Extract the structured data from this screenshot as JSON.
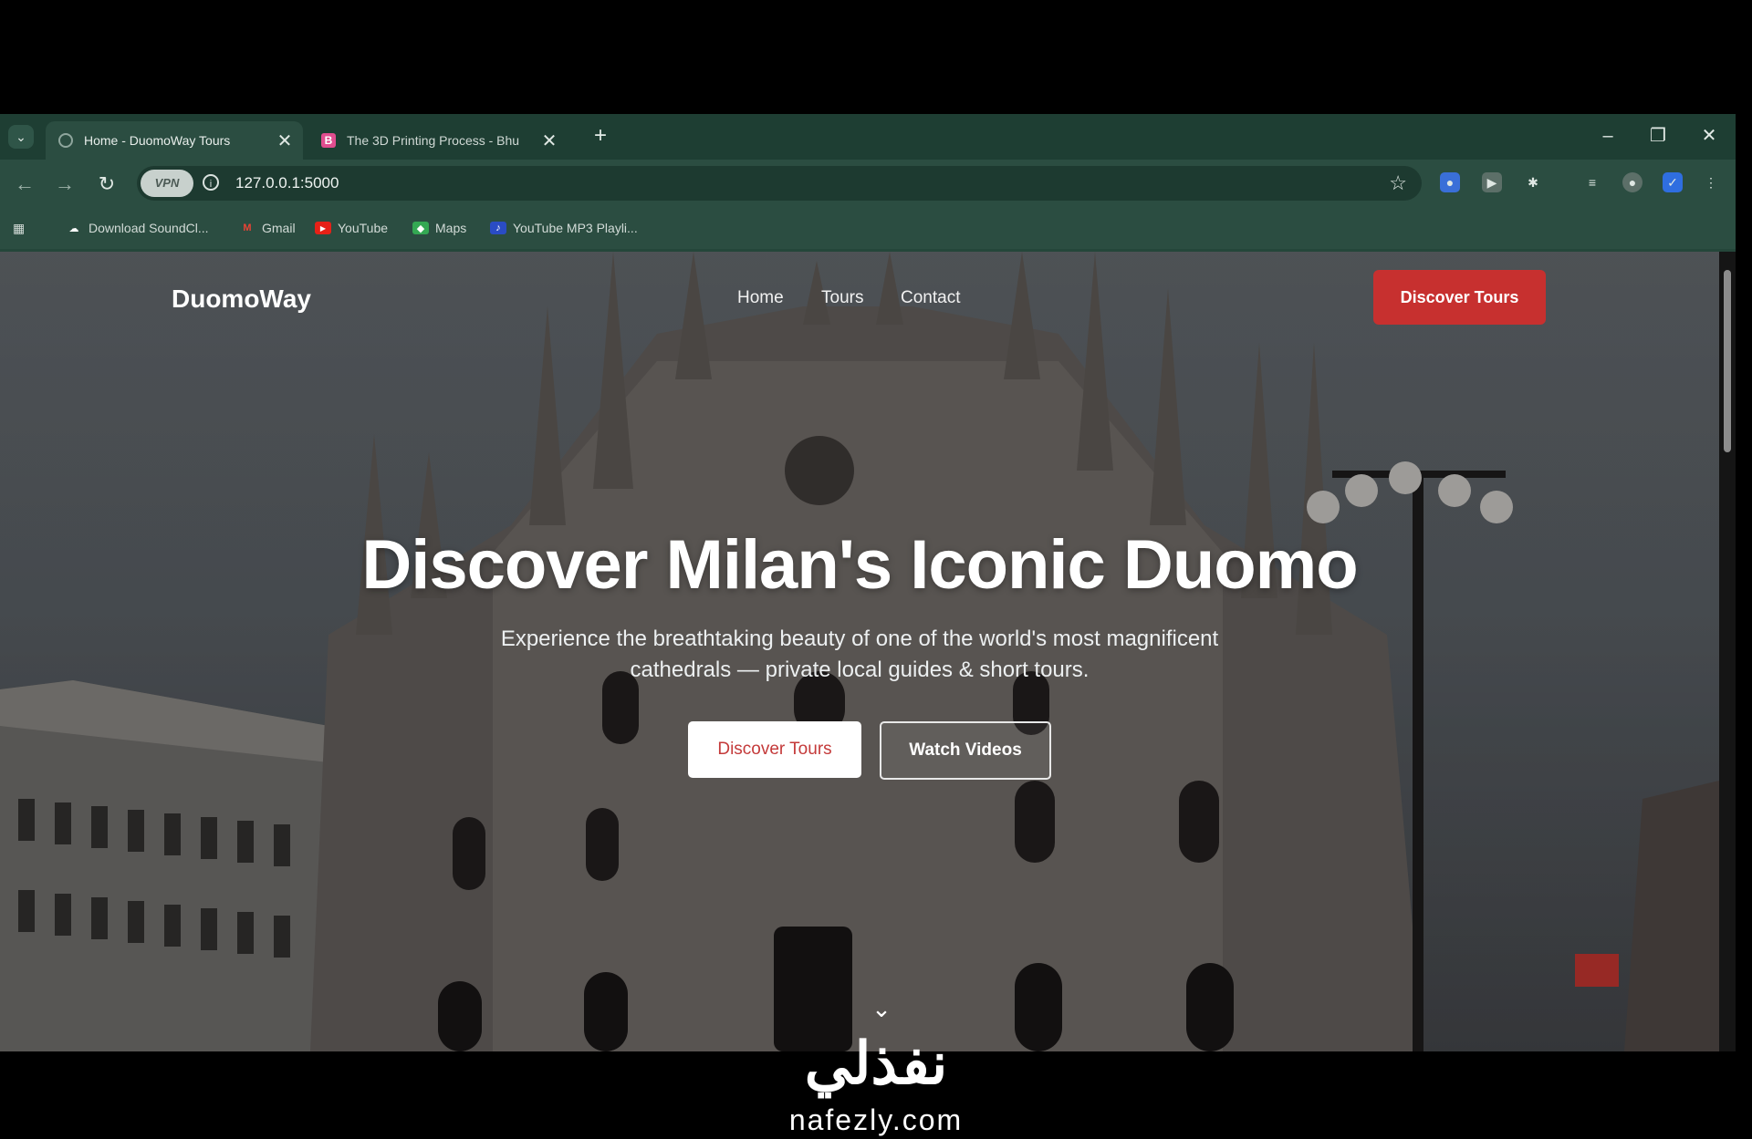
{
  "browser": {
    "tabs": [
      {
        "title": "Home - DuomoWay Tours",
        "active": true
      },
      {
        "title": "The 3D Printing Process - Bhu",
        "active": false
      }
    ],
    "new_tab": "+",
    "url": "127.0.0.1:5000",
    "vpn_label": "VPN",
    "bookmarks": [
      {
        "label": "Download SoundCl...",
        "icon": "cloud-icon"
      },
      {
        "label": "Gmail",
        "icon": "gmail-icon"
      },
      {
        "label": "YouTube",
        "icon": "youtube-icon"
      },
      {
        "label": "Maps",
        "icon": "maps-icon"
      },
      {
        "label": "YouTube MP3 Playli...",
        "icon": "music-icon"
      }
    ]
  },
  "site": {
    "brand": "DuomoWay",
    "nav": {
      "home": "Home",
      "tours": "Tours",
      "contact": "Contact"
    },
    "nav_cta": "Discover Tours",
    "hero": {
      "title": "Discover Milan's Iconic Duomo",
      "subtitle": "Experience the breathtaking beauty of one of the world's most magnificent cathedrals — private local guides & short tours.",
      "primary_button": "Discover Tours",
      "secondary_button": "Watch Videos"
    },
    "accent_color": "#c7302f"
  },
  "watermark": {
    "arabic": "نفذلي",
    "latin": "nafezly.com"
  }
}
